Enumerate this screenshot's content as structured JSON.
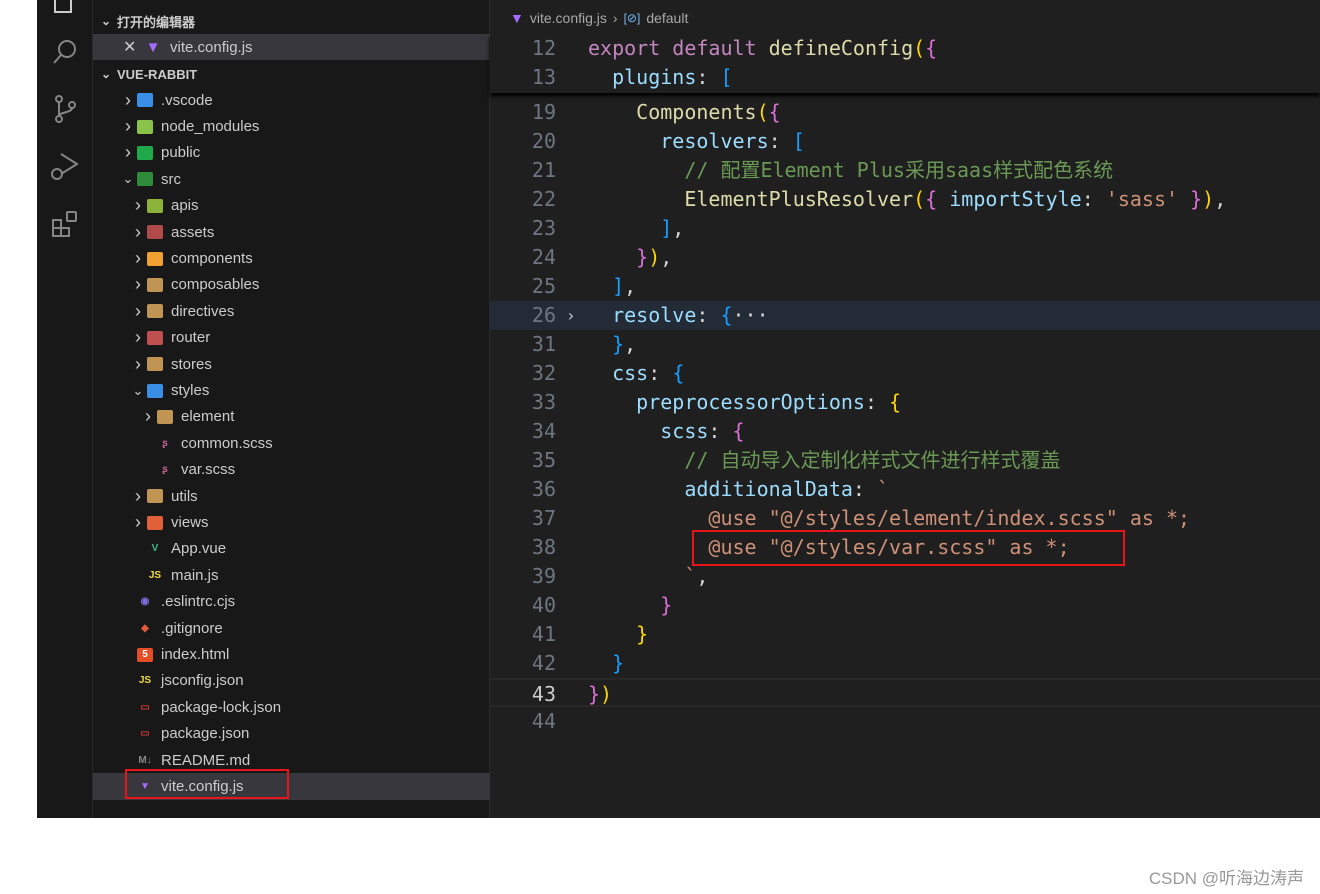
{
  "sidebar": {
    "open_editors_title": "打开的编辑器",
    "open_editors": [
      {
        "label": "vite.config.js",
        "icon": "vite-icon"
      }
    ],
    "project_title": "VUE-RABBIT",
    "tree": [
      {
        "label": ".vscode",
        "level": 1,
        "type": "folder",
        "expanded": false,
        "icon": "vscode-folder-icon",
        "color": "#3a8ee6"
      },
      {
        "label": "node_modules",
        "level": 1,
        "type": "folder",
        "expanded": false,
        "icon": "node-folder-icon",
        "color": "#8bc34a"
      },
      {
        "label": "public",
        "level": 1,
        "type": "folder",
        "expanded": false,
        "icon": "public-folder-icon",
        "color": "#1fa94b"
      },
      {
        "label": "src",
        "level": 1,
        "type": "folder",
        "expanded": true,
        "icon": "src-folder-icon",
        "color": "#2e8b3a"
      },
      {
        "label": "apis",
        "level": 2,
        "type": "folder",
        "expanded": false,
        "icon": "api-folder-icon",
        "color": "#8bb33a"
      },
      {
        "label": "assets",
        "level": 2,
        "type": "folder",
        "expanded": false,
        "icon": "assets-folder-icon",
        "color": "#b04a4a"
      },
      {
        "label": "components",
        "level": 2,
        "type": "folder",
        "expanded": false,
        "icon": "components-folder-icon",
        "color": "#f0a030"
      },
      {
        "label": "composables",
        "level": 2,
        "type": "folder",
        "expanded": false,
        "icon": "folder-icon",
        "color": "#c09553"
      },
      {
        "label": "directives",
        "level": 2,
        "type": "folder",
        "expanded": false,
        "icon": "folder-icon",
        "color": "#c09553"
      },
      {
        "label": "router",
        "level": 2,
        "type": "folder",
        "expanded": false,
        "icon": "router-folder-icon",
        "color": "#c05050"
      },
      {
        "label": "stores",
        "level": 2,
        "type": "folder",
        "expanded": false,
        "icon": "folder-icon",
        "color": "#c09553"
      },
      {
        "label": "styles",
        "level": 2,
        "type": "folder",
        "expanded": true,
        "icon": "styles-folder-icon",
        "color": "#3a8ee6"
      },
      {
        "label": "element",
        "level": 3,
        "type": "folder",
        "expanded": false,
        "icon": "folder-icon",
        "color": "#c09553"
      },
      {
        "label": "common.scss",
        "level": 3,
        "type": "file",
        "icon": "sass-icon",
        "color": "#cd6799"
      },
      {
        "label": "var.scss",
        "level": 3,
        "type": "file",
        "icon": "sass-icon",
        "color": "#cd6799"
      },
      {
        "label": "utils",
        "level": 2,
        "type": "folder",
        "expanded": false,
        "icon": "utils-folder-icon",
        "color": "#c09553"
      },
      {
        "label": "views",
        "level": 2,
        "type": "folder",
        "expanded": false,
        "icon": "views-folder-icon",
        "color": "#e0603a"
      },
      {
        "label": "App.vue",
        "level": 2,
        "type": "file",
        "icon": "vue-icon",
        "color": "#41b883"
      },
      {
        "label": "main.js",
        "level": 2,
        "type": "file",
        "icon": "js-icon",
        "color": "#f1dd35"
      },
      {
        "label": ".eslintrc.cjs",
        "level": 1,
        "type": "file",
        "icon": "eslint-icon",
        "color": "#7c6fe0"
      },
      {
        "label": ".gitignore",
        "level": 1,
        "type": "file",
        "icon": "git-icon",
        "color": "#e05a3a"
      },
      {
        "label": "index.html",
        "level": 1,
        "type": "file",
        "icon": "html-icon",
        "color": "#e44d26"
      },
      {
        "label": "jsconfig.json",
        "level": 1,
        "type": "file",
        "icon": "jsconfig-icon",
        "color": "#f1dd35"
      },
      {
        "label": "package-lock.json",
        "level": 1,
        "type": "file",
        "icon": "npm-icon",
        "color": "#cb3837"
      },
      {
        "label": "package.json",
        "level": 1,
        "type": "file",
        "icon": "npm-icon",
        "color": "#cb3837"
      },
      {
        "label": "README.md",
        "level": 1,
        "type": "file",
        "icon": "markdown-icon",
        "color": "#888"
      },
      {
        "label": "vite.config.js",
        "level": 1,
        "type": "file",
        "icon": "vite-icon",
        "color": "#a56cff",
        "selected": true
      }
    ]
  },
  "editor": {
    "breadcrumb": [
      "vite.config.js",
      "default"
    ],
    "sticky": [
      {
        "n": "12",
        "t": [
          [
            "export ",
            "kw"
          ],
          [
            "default ",
            "kw"
          ],
          [
            "defineConfig",
            "fn"
          ],
          [
            "(",
            "b1"
          ],
          [
            "{",
            "b2"
          ]
        ]
      },
      {
        "n": "13",
        "t": [
          [
            "  plugins",
            "pr"
          ],
          [
            ": ",
            "pn"
          ],
          [
            "[",
            "b3"
          ]
        ]
      }
    ],
    "lines": [
      {
        "n": "19",
        "t": [
          [
            "    Components",
            "fn"
          ],
          [
            "(",
            "b1"
          ],
          [
            "{",
            "b2"
          ]
        ]
      },
      {
        "n": "20",
        "t": [
          [
            "      resolvers",
            "pr"
          ],
          [
            ": ",
            "pn"
          ],
          [
            "[",
            "b3"
          ]
        ]
      },
      {
        "n": "21",
        "t": [
          [
            "        // 配置Element Plus采用saas样式配色系统",
            "cm"
          ]
        ]
      },
      {
        "n": "22",
        "t": [
          [
            "        ElementPlusResolver",
            "fn"
          ],
          [
            "(",
            "b1"
          ],
          [
            "{ ",
            "b2"
          ],
          [
            "importStyle",
            "pr"
          ],
          [
            ": ",
            "pn"
          ],
          [
            "'sass'",
            "st"
          ],
          [
            " }",
            "b2"
          ],
          [
            ")",
            "b1"
          ],
          [
            ",",
            "pn"
          ]
        ]
      },
      {
        "n": "23",
        "t": [
          [
            "      ]",
            "b3"
          ],
          [
            ",",
            "pn"
          ]
        ]
      },
      {
        "n": "24",
        "t": [
          [
            "    }",
            "b2"
          ],
          [
            ")",
            "b1"
          ],
          [
            ",",
            "pn"
          ]
        ]
      },
      {
        "n": "25",
        "t": [
          [
            "  ]",
            "b3"
          ],
          [
            ",",
            "pn"
          ]
        ]
      },
      {
        "n": "26",
        "t": [
          [
            "  resolve",
            "pr"
          ],
          [
            ": ",
            "pn"
          ],
          [
            "{",
            "b3"
          ],
          [
            "···",
            "pn"
          ]
        ],
        "folded": true
      },
      {
        "n": "31",
        "t": [
          [
            "  }",
            "b3"
          ],
          [
            ",",
            "pn"
          ]
        ]
      },
      {
        "n": "32",
        "t": [
          [
            "  css",
            "pr"
          ],
          [
            ": ",
            "pn"
          ],
          [
            "{",
            "b3"
          ]
        ]
      },
      {
        "n": "33",
        "t": [
          [
            "    preprocessorOptions",
            "pr"
          ],
          [
            ": ",
            "pn"
          ],
          [
            "{",
            "b1"
          ]
        ]
      },
      {
        "n": "34",
        "t": [
          [
            "      scss",
            "pr"
          ],
          [
            ": ",
            "pn"
          ],
          [
            "{",
            "b2"
          ]
        ]
      },
      {
        "n": "35",
        "t": [
          [
            "        // 自动导入定制化样式文件进行样式覆盖",
            "cm"
          ]
        ]
      },
      {
        "n": "36",
        "t": [
          [
            "        additionalData",
            "pr"
          ],
          [
            ": ",
            "pn"
          ],
          [
            "`",
            "st"
          ]
        ]
      },
      {
        "n": "37",
        "t": [
          [
            "          @use \"@/styles/element/index.scss\" as *;",
            "st"
          ]
        ]
      },
      {
        "n": "38",
        "t": [
          [
            "          @use \"@/styles/var.scss\" as *;",
            "st"
          ]
        ]
      },
      {
        "n": "39",
        "t": [
          [
            "        `",
            "st"
          ],
          [
            ",",
            "pn"
          ]
        ]
      },
      {
        "n": "40",
        "t": [
          [
            "      }",
            "b2"
          ]
        ]
      },
      {
        "n": "41",
        "t": [
          [
            "    }",
            "b1"
          ]
        ]
      },
      {
        "n": "42",
        "t": [
          [
            "  }",
            "b3"
          ]
        ]
      },
      {
        "n": "43",
        "t": [
          [
            "}",
            "b2"
          ],
          [
            ")",
            "b1"
          ]
        ],
        "current": true
      },
      {
        "n": "44",
        "t": []
      }
    ]
  },
  "watermark": "CSDN @听海边涛声"
}
